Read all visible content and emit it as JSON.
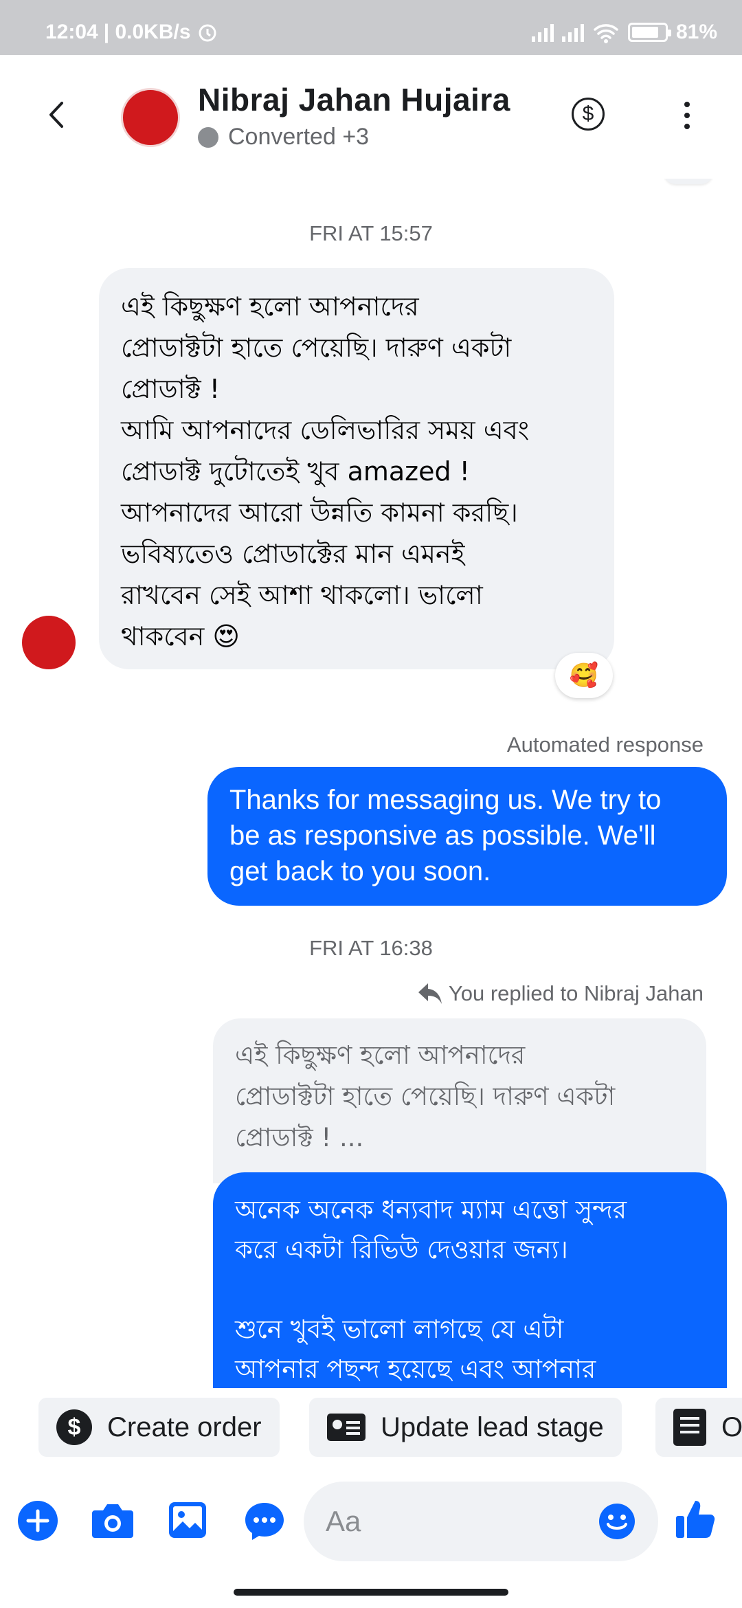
{
  "status_bar": {
    "time": "12:04",
    "network_speed": "| 0.0KB/s",
    "battery": "81%"
  },
  "header": {
    "contact_name": "Nibraj Jahan Hujaira",
    "label": "Converted +3",
    "icons": [
      "back-arrow-icon",
      "dollar-icon",
      "more-vertical-icon"
    ]
  },
  "chat": {
    "timestamp_1": "FRI AT 15:57",
    "incoming_message": "এই কিছুক্ষণ হলো আপনাদের\nপ্রোডাক্টটা হাতে পেয়েছি। দারুণ একটা\nপ্রোডাক্ট !\nআমি আপনাদের ডেলিভারির সময় এবং\nপ্রোডাক্ট দুটোতেই খুব amazed !\nআপনাদের আরো উন্নতি কামনা করছি।\nভবিষ্যতেও প্রোডাক্টের মান এমনই\nরাখবেন সেই আশা থাকলো। ভালো\nথাকবেন 😍",
    "reaction": "🥰",
    "automated_label": "Automated response",
    "automated_message": "Thanks for messaging us. We try to\nbe as responsive as possible. We'll\nget back to you soon.",
    "timestamp_2": "FRI AT 16:38",
    "replied_note": "You replied to Nibraj Jahan",
    "quoted_message": "এই কিছুক্ষণ হলো আপনাদের\nপ্রোডাক্টটা হাতে পেয়েছি। দারুণ একটা\nপ্রোডাক্ট ! ...",
    "reply_message": "অনেক অনেক ধন্যবাদ ম্যাম এত্তো সুন্দর\nকরে একটা রিভিউ দেওয়ার জন্য।\n\nশুনে খুবই ভালো লাগছে যে এটা\nআপনার পছন্দ হয়েছে এবং আপনার"
  },
  "actions": {
    "create_order": "Create order",
    "update_lead_stage": "Update lead stage",
    "third_partial": "O"
  },
  "composer": {
    "placeholder": "Aa",
    "icons": [
      "plus-icon",
      "camera-icon",
      "gallery-icon",
      "chat-extensions-icon",
      "emoji-icon",
      "like-icon"
    ]
  },
  "colors": {
    "accent_blue": "#0a66ff",
    "bubble_gray": "#f0f2f5",
    "avatar_red": "#d0191d"
  }
}
